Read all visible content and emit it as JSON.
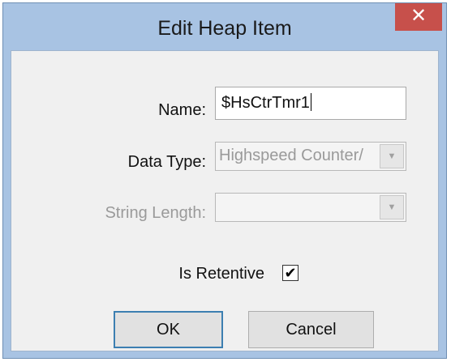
{
  "window": {
    "title": "Edit Heap Item",
    "close_glyph": "✕"
  },
  "form": {
    "name_label": "Name:",
    "name_value": "$HsCtrTmr1",
    "data_type_label": "Data Type:",
    "data_type_value": "Highspeed Counter/",
    "string_length_label": "String Length:",
    "string_length_value": "",
    "retentive_label": "Is Retentive",
    "retentive_checked": true,
    "check_glyph": "✔"
  },
  "buttons": {
    "ok_label": "OK",
    "cancel_label": "Cancel"
  },
  "icons": {
    "close": "close-icon",
    "dropdown": "chevron-down-icon",
    "check": "checkmark-icon"
  }
}
